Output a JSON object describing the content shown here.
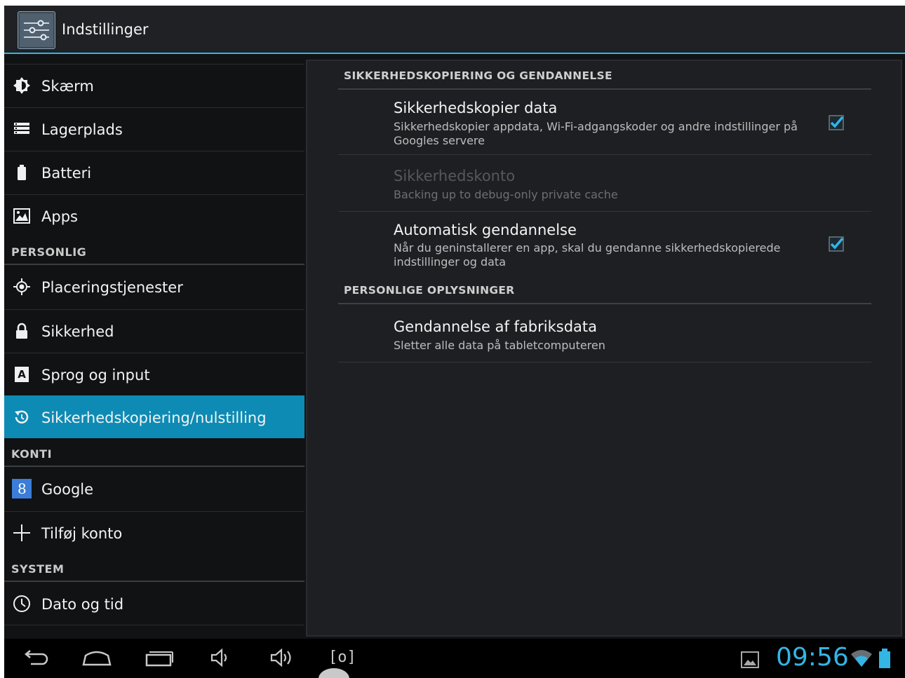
{
  "action_bar": {
    "title": "Indstillinger",
    "icon": "settings-sliders-icon"
  },
  "sidebar": {
    "items_top": [
      {
        "label": "Skærm",
        "icon": "brightness-icon"
      },
      {
        "label": "Lagerplads",
        "icon": "storage-icon"
      },
      {
        "label": "Batteri",
        "icon": "battery-icon"
      },
      {
        "label": "Apps",
        "icon": "apps-icon"
      }
    ],
    "header_personal": "PERSONLIG",
    "items_personal": [
      {
        "label": "Placeringstjenester",
        "icon": "location-icon"
      },
      {
        "label": "Sikkerhed",
        "icon": "lock-icon"
      },
      {
        "label": "Sprog og input",
        "icon": "language-icon"
      },
      {
        "label": "Sikkerhedskopiering/nulstilling",
        "icon": "backup-icon",
        "selected": true
      }
    ],
    "header_accounts": "KONTI",
    "items_accounts": [
      {
        "label": "Google",
        "icon": "google-icon",
        "icon_text": "8"
      },
      {
        "label": "Tilføj konto",
        "icon": "plus-icon"
      }
    ],
    "header_system": "SYSTEM",
    "items_system": [
      {
        "label": "Dato og tid",
        "icon": "clock-icon"
      }
    ]
  },
  "content": {
    "section_backup": "SIKKERHEDSKOPIERING OG GENDANNELSE",
    "backup_data": {
      "title": "Sikkerhedskopier data",
      "summary": "Sikkerhedskopier appdata, Wi-Fi-adgangskoder og andre indstillinger på Googles servere",
      "checked": true
    },
    "backup_account": {
      "title": "Sikkerhedskonto",
      "summary": "Backing up to debug-only private cache",
      "enabled": false
    },
    "auto_restore": {
      "title": "Automatisk gendannelse",
      "summary": "Når du geninstallerer en app, skal du gendanne sikkerhedskopierede indstillinger og data",
      "checked": true
    },
    "section_personal": "PERSONLIGE OPLYSNINGER",
    "factory_reset": {
      "title": "Gendannelse af fabriksdata",
      "summary": "Sletter alle data på tabletcomputeren"
    }
  },
  "navbar": {
    "buttons": [
      "back-icon",
      "home-icon",
      "recents-icon",
      "volume-down-icon",
      "volume-up-icon",
      "screenshot-icon"
    ],
    "screenshot_glyph": "[o]",
    "clock": "09:56",
    "status_icons": [
      "gallery-notification-icon",
      "wifi-icon",
      "battery-status-icon"
    ]
  },
  "colors": {
    "accent": "#33b5e5",
    "selected": "#0d8bb4",
    "background": "#111214"
  }
}
